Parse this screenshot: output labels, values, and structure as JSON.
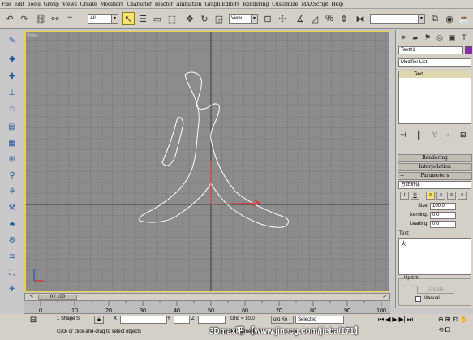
{
  "menu": [
    "File",
    "Edit",
    "Tools",
    "Group",
    "Views",
    "Create",
    "Modifiers",
    "Character",
    "reactor",
    "Animation",
    "Graph Editors",
    "Rendering",
    "Customize",
    "MAXScript",
    "Help"
  ],
  "toolbar": {
    "selection_filter": "All",
    "reference_coord": "View"
  },
  "viewport": {
    "label": "Front",
    "shape_color": "#ffffff",
    "grid_color": "#7a7a7a",
    "axis_color": "#3a3a3a",
    "border_color": "#e6d34a"
  },
  "panel": {
    "object_name": "Text01",
    "object_color": "#8a2bb0",
    "modifier_list": "Modifier List",
    "stack_item": "Text",
    "rollouts": {
      "rendering": "Rendering",
      "interpolation": "Interpolation",
      "parameters": "Parameters"
    },
    "font_name": "方正舒体",
    "size_label": "Size:",
    "size_value": "100.0",
    "kerning_label": "Kerning:",
    "kerning_value": "0.0",
    "leading_label": "Leading:",
    "leading_value": "0.0",
    "text_label": "Text:",
    "text_value": "火",
    "update_group": "Update",
    "update_button": "Update",
    "manual_label": "Manual"
  },
  "timeline": {
    "frame": "0 / 100",
    "ticks": [
      "0",
      "10",
      "20",
      "30",
      "40",
      "50",
      "60",
      "70",
      "80",
      "90",
      "100"
    ]
  },
  "status": {
    "selection": "1 Shape S",
    "x_label": "X",
    "y_label": "Y",
    "z_label": "Z",
    "grid": "Grid = 10.0",
    "prompt": "Click or click-and-drag to select objects",
    "add_time_tag": "Add Time Tag",
    "auto_key": "uto Ke",
    "selected": "Selected"
  },
  "watermark": "3Dmax吧 【www.jinecg.com/jieba/171】"
}
